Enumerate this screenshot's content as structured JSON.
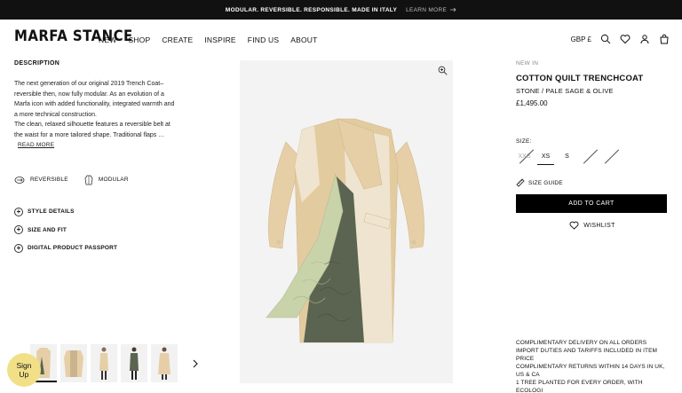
{
  "topbar": {
    "message": "MODULAR. REVERSIBLE. RESPONSIBLE. MADE IN ITALY",
    "link": "LEARN MORE"
  },
  "header": {
    "logo": "MARFA STANCE",
    "nav": [
      "NEW",
      "SHOP",
      "CREATE",
      "INSPIRE",
      "FIND US",
      "ABOUT"
    ],
    "currency": "GBP £"
  },
  "description": {
    "title": "DESCRIPTION",
    "line1": "The next generation of our original 2019 Trench Coat–reversible then, now fully modular. As an evolution of a Marfa icon with added functionality, integrated warmth and a more technical construction.",
    "line2": "The clean, relaxed silhouette features a reversible belt at the waist for a more tailored shape. Traditional flaps …",
    "read_more": "READ MORE"
  },
  "features": [
    {
      "label": "REVERSIBLE",
      "icon": "reversible-icon"
    },
    {
      "label": "MODULAR",
      "icon": "modular-icon"
    }
  ],
  "accordions": [
    "STYLE DETAILS",
    "SIZE AND FIT",
    "DIGITAL PRODUCT PASSPORT"
  ],
  "signup": {
    "line1": "Sign",
    "line2": "Up"
  },
  "product": {
    "badge": "NEW IN",
    "name": "COTTON QUILT TRENCHCOAT",
    "color": "STONE / PALE SAGE & OLIVE",
    "price": "£1,495.00"
  },
  "sizes": {
    "label": "SIZE:",
    "options": [
      {
        "label": "XXS",
        "available": false
      },
      {
        "label": "XS",
        "available": true,
        "selected": true
      },
      {
        "label": "S",
        "available": true
      },
      {
        "label": "M",
        "available": false
      },
      {
        "label": "L",
        "available": false
      }
    ]
  },
  "actions": {
    "size_guide": "SIZE GUIDE",
    "add_to_cart": "ADD TO CART",
    "wishlist": "WISHLIST"
  },
  "info": {
    "line1": "COMPLIMENTARY DELIVERY ON ALL ORDERS",
    "line2": "IMPORT DUTIES AND TARIFFS INCLUDED IN ITEM PRICE",
    "line3": "COMPLIMENTARY RETURNS WITHIN 14 DAYS IN UK, US & CA",
    "line4": "1 TREE PLANTED FOR EVERY ORDER, WITH ECOLOGI"
  },
  "colors": {
    "stone": "#e6cfa7",
    "pale_sage": "#c9d3aa",
    "olive": "#5b6450",
    "signup": "#f2e088"
  }
}
